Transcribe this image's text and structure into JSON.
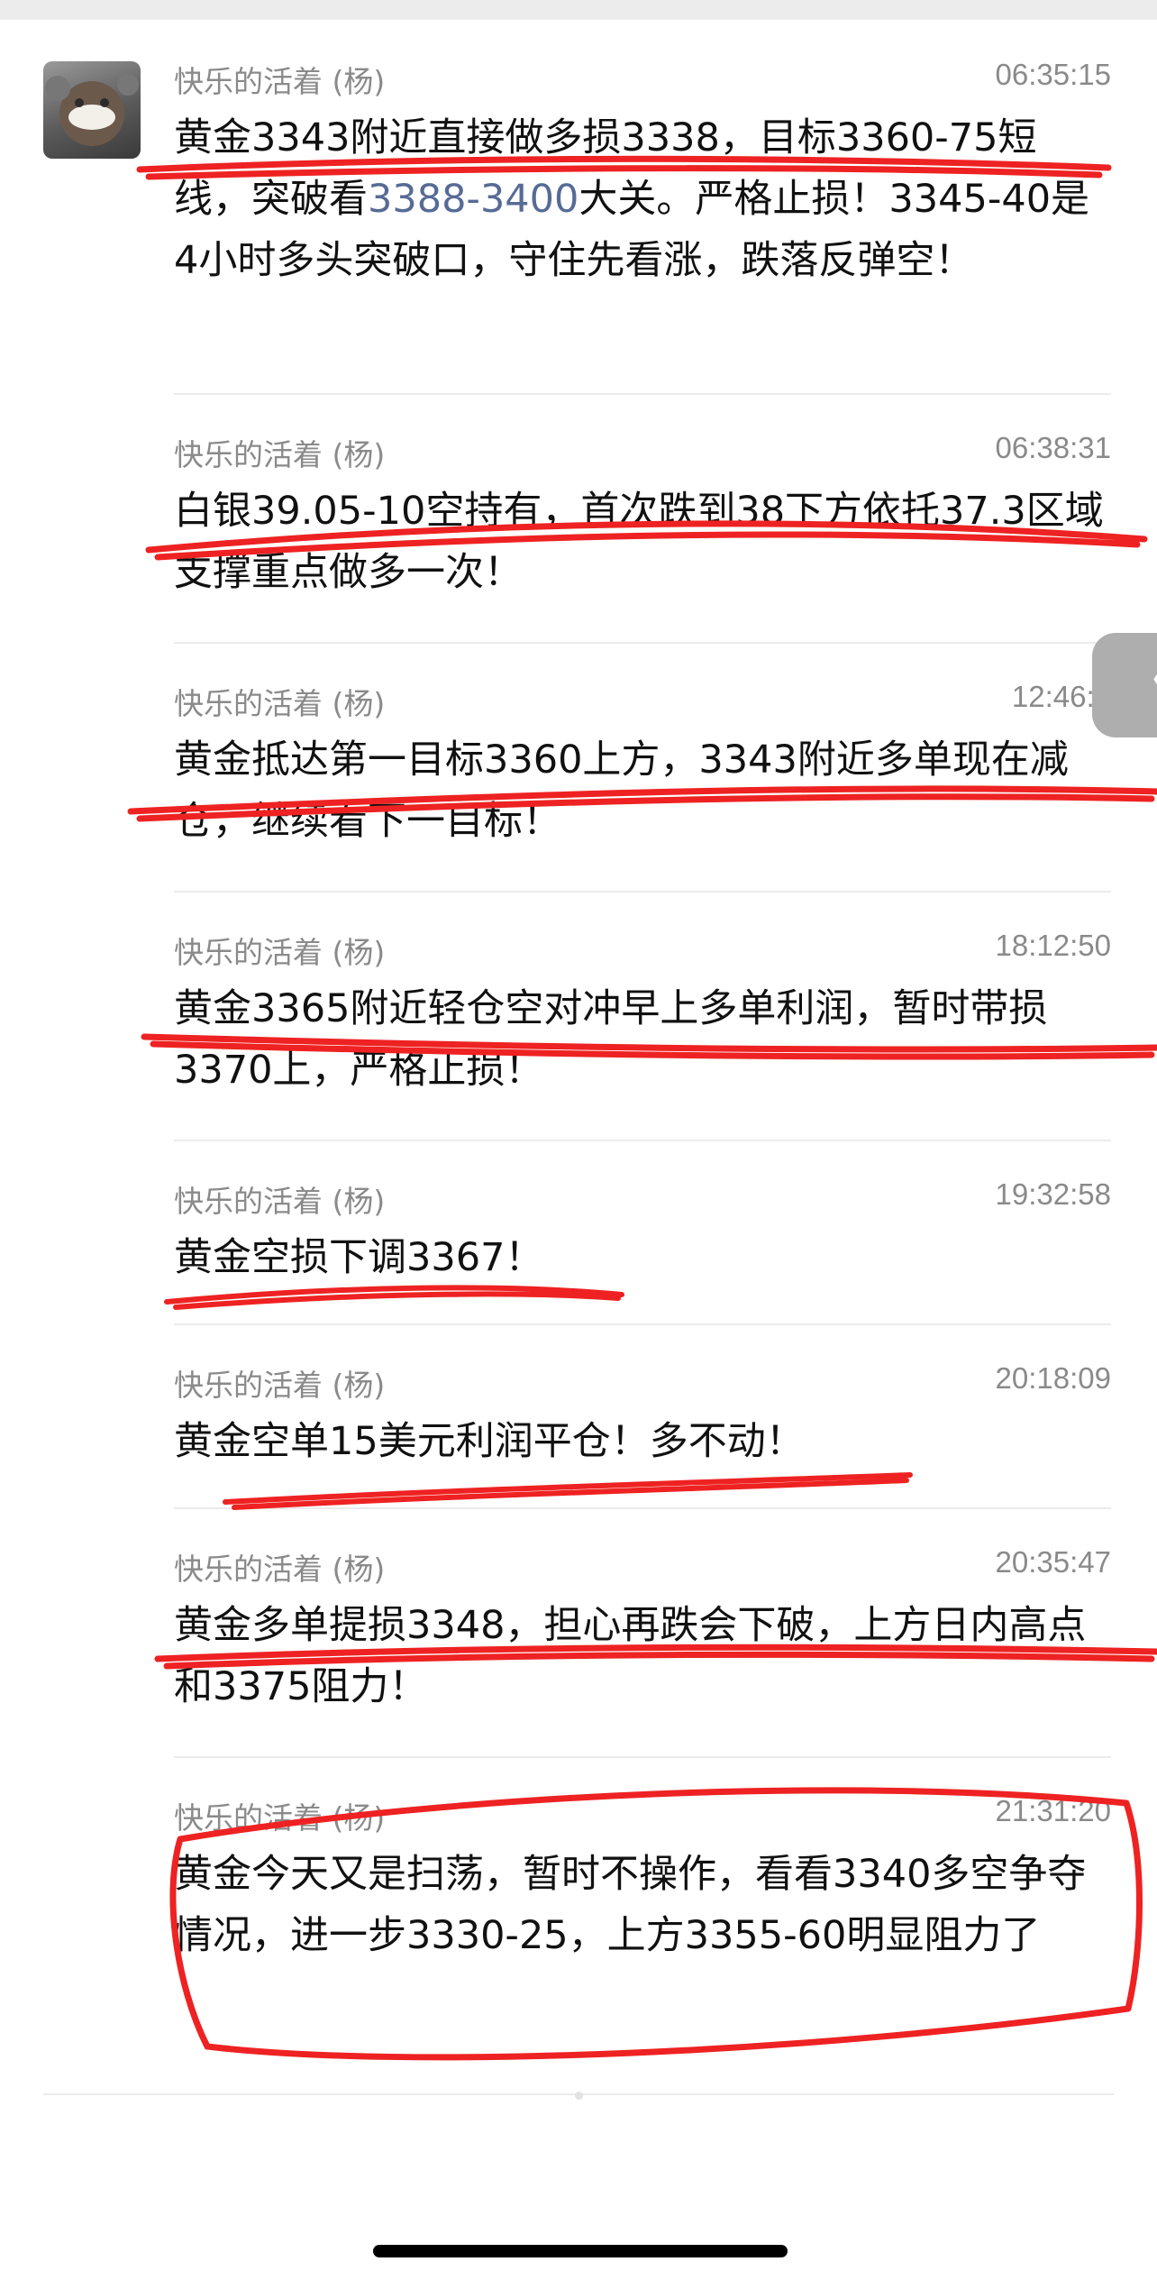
{
  "sender_name": "快乐的活着 (杨)",
  "messages": [
    {
      "time": "06:35:15",
      "text_before": "黄金3343附近直接做多损3338，目标3360-75短线，突破看",
      "link": "3388-3400",
      "text_after": "大关。严格止损！3345-40是4小时多头突破口，守住先看涨，跌落反弹空！"
    },
    {
      "time": "06:38:31",
      "text": "白银39.05-10空持有，首次跌到38下方依托37.3区域支撑重点做多一次！"
    },
    {
      "time": "12:46:5",
      "text": "黄金抵达第一目标3360上方，3343附近多单现在减仓，继续看下一目标！"
    },
    {
      "time": "18:12:50",
      "text": "黄金3365附近轻仓空对冲早上多单利润，暂时带损3370上，严格止损！"
    },
    {
      "time": "19:32:58",
      "text": "黄金空损下调3367！"
    },
    {
      "time": "20:18:09",
      "text": "黄金空单15美元利润平仓！多不动！"
    },
    {
      "time": "20:35:47",
      "text": "黄金多单提损3348，担心再跌会下破，上方日内高点和3375阻力！"
    },
    {
      "time": "21:31:20",
      "text": "黄金今天又是扫荡，暂时不操作，看看3340多空争夺情况，进一步3330-25，上方3355-60明显阻力了"
    }
  ],
  "side_handle_glyph": "〈",
  "colors": {
    "annotation": "#ee2222",
    "link": "#566b95",
    "meta": "#8a8a8a"
  }
}
